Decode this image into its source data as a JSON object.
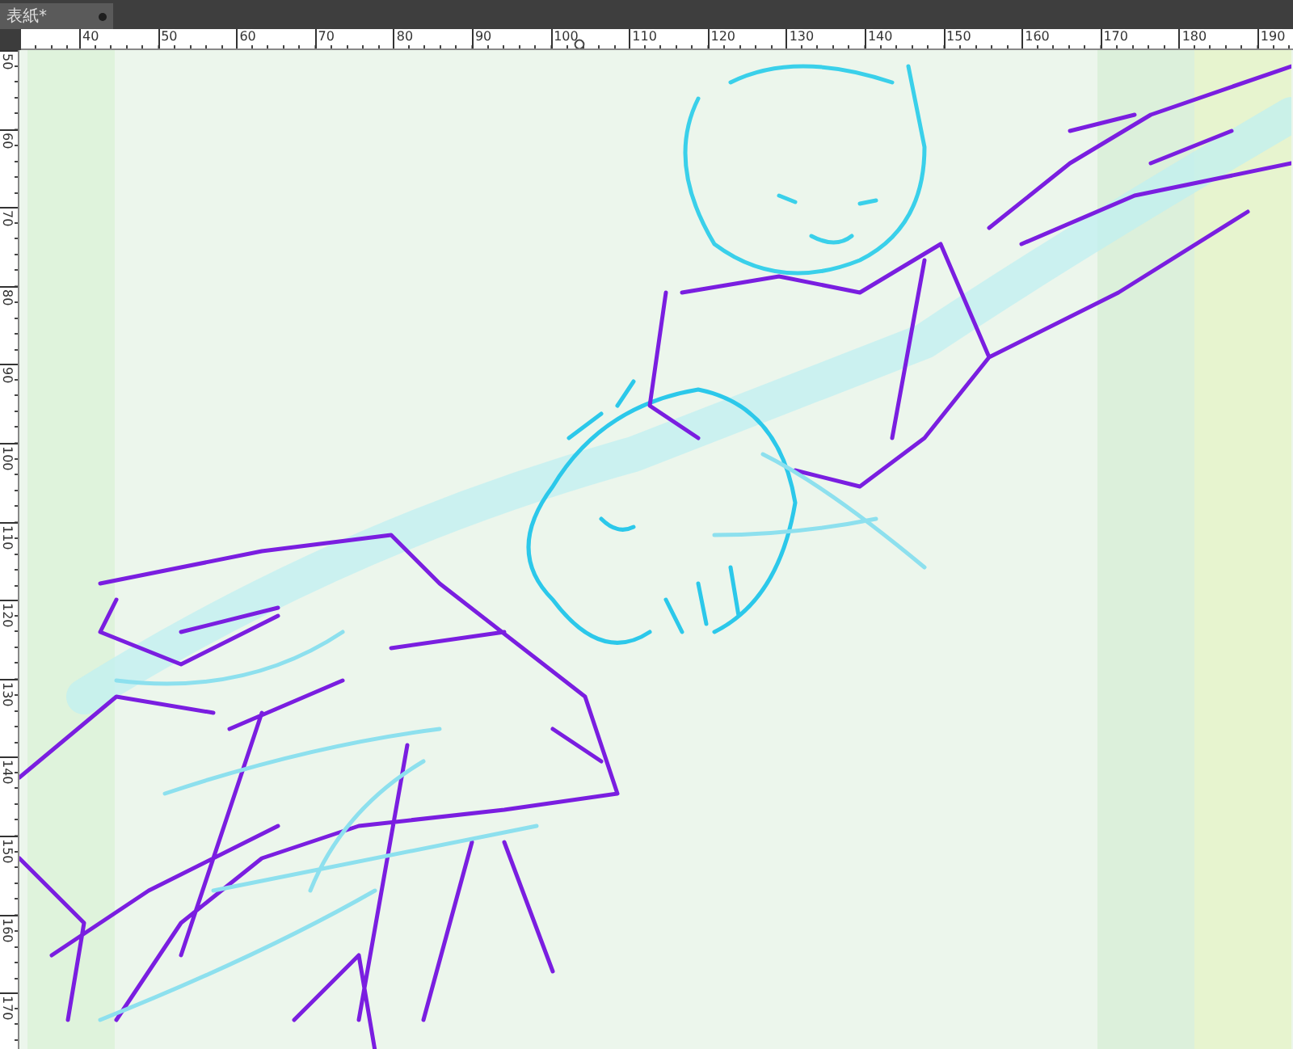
{
  "tab": {
    "label": "表紙*"
  },
  "ruler_horizontal": {
    "labels": [
      "40",
      "50",
      "60",
      "70",
      "80",
      "90",
      "100",
      "110",
      "120",
      "130",
      "140",
      "150",
      "160",
      "170",
      "180",
      "190"
    ]
  },
  "ruler_vertical": {
    "labels": [
      "50",
      "60",
      "70",
      "80",
      "90",
      "100",
      "110",
      "120",
      "130",
      "140",
      "150",
      "160",
      "170"
    ]
  }
}
